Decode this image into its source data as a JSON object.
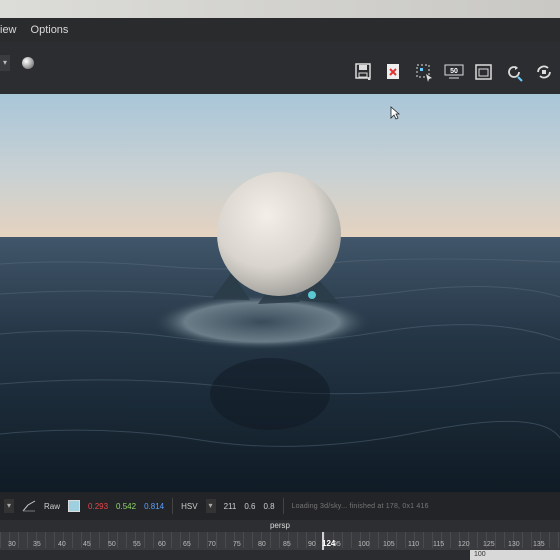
{
  "menu": {
    "items": [
      "iew",
      "Options"
    ]
  },
  "toolbar": {
    "icons": [
      "save-image-icon",
      "remove-image-icon",
      "region-render-icon",
      "snapshot-50-icon",
      "frame-icon",
      "refresh-icon",
      "ipr-icon"
    ],
    "snapshot_label": "50"
  },
  "status": {
    "channel": "Raw",
    "r": "0.293",
    "g": "0.542",
    "b": "0.814",
    "mode": "HSV",
    "h": "211",
    "s": "0.6",
    "v": "0.8",
    "message": "Loading 3d/sky... finished at 178, 0x1 416"
  },
  "camera": {
    "label": "persp"
  },
  "timeline": {
    "current_frame": "124",
    "ticks": [
      "30",
      "35",
      "40",
      "45",
      "50",
      "55",
      "60",
      "65",
      "70",
      "75",
      "80",
      "85",
      "90",
      "95",
      "100",
      "105",
      "110",
      "115",
      "120",
      "125",
      "130",
      "135"
    ],
    "end_field": "100"
  },
  "colors": {
    "accent": "#9ed0df",
    "red": "#e8474a",
    "green": "#8ed96b",
    "blue": "#5aa0ff"
  }
}
